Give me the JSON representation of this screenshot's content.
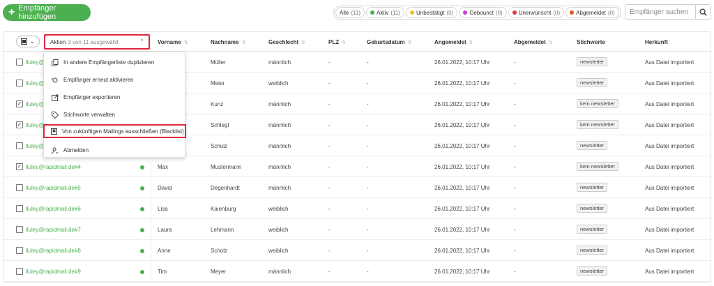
{
  "toolbar": {
    "add_label": "Empfänger hinzufügen",
    "search_placeholder": "Empfänger suchen",
    "filters": [
      {
        "label": "Alle",
        "count": "(11)",
        "color": ""
      },
      {
        "label": "Aktiv",
        "count": "(11)",
        "color": "#4caf50"
      },
      {
        "label": "Unbestätigt",
        "count": "(0)",
        "color": "#f0c020"
      },
      {
        "label": "Gebounct",
        "count": "(0)",
        "color": "#c040d0"
      },
      {
        "label": "Unerwünscht",
        "count": "(0)",
        "color": "#e0304a"
      },
      {
        "label": "Abgemeldet",
        "count": "(0)",
        "color": "#e05a20"
      }
    ]
  },
  "header": {
    "aktion_label": "Aktion",
    "aktion_selected": "3 von 11 ausgewählt",
    "columns": [
      "Vorname",
      "Nachname",
      "Geschlecht",
      "PLZ",
      "Geburtsdatum",
      "Angemeldet",
      "Abgemeldet",
      "Stichworte",
      "Herkunft"
    ]
  },
  "menu": {
    "items": [
      {
        "label": "In andere Empfängerliste duplizieren",
        "icon": "copy-icon"
      },
      {
        "label": "Empfänger erneut aktivieren",
        "icon": "reactivate-icon"
      },
      {
        "label": "Empfänger exportieren",
        "icon": "export-icon"
      },
      {
        "label": "Stichworte verwalten",
        "icon": "tag-icon"
      },
      {
        "label": "Von zukünftigen Mailings ausschließen (Blacklist)",
        "icon": "blacklist-icon"
      },
      {
        "label": "Abmelden",
        "icon": "unsubscribe-icon"
      }
    ]
  },
  "rows": [
    {
      "email": "lluley@rapidmail.de",
      "checked": false,
      "vorname": "",
      "nachname": "Müller",
      "geschlecht": "männlich",
      "plz": "-",
      "geburtsdatum": "-",
      "angemeldet": "26.01.2022, 10:17 Uhr",
      "abgemeldet": "-",
      "stichwort": "newsletter",
      "herkunft": "Aus Datei importiert"
    },
    {
      "email": "lluley@",
      "checked": false,
      "vorname": "",
      "nachname": "Meier",
      "geschlecht": "weiblich",
      "plz": "-",
      "geburtsdatum": "-",
      "angemeldet": "26.01.2022, 10:17 Uhr",
      "abgemeldet": "-",
      "stichwort": "newsletter",
      "herkunft": "Aus Datei importiert"
    },
    {
      "email": "lluley@",
      "checked": true,
      "vorname": "",
      "nachname": "Kunz",
      "geschlecht": "männlich",
      "plz": "-",
      "geburtsdatum": "-",
      "angemeldet": "26.01.2022, 10:17 Uhr",
      "abgemeldet": "-",
      "stichwort": "kein newsletter",
      "herkunft": "Aus Datei importiert"
    },
    {
      "email": "lluley@",
      "checked": true,
      "vorname": "",
      "nachname": "Schlegl",
      "geschlecht": "männlich",
      "plz": "-",
      "geburtsdatum": "-",
      "angemeldet": "26.01.2022, 10:17 Uhr",
      "abgemeldet": "-",
      "stichwort": "kein newsletter",
      "herkunft": "Aus Datei importiert"
    },
    {
      "email": "lluley@",
      "checked": false,
      "vorname": "",
      "nachname": "Schulz",
      "geschlecht": "männlich",
      "plz": "-",
      "geburtsdatum": "-",
      "angemeldet": "26.01.2022, 10:17 Uhr",
      "abgemeldet": "-",
      "stichwort": "newsletter",
      "herkunft": "Aus Datei importiert"
    },
    {
      "email": "lluley@rapidmail.de#4",
      "checked": true,
      "vorname": "Max",
      "nachname": "Mustermann",
      "geschlecht": "männlich",
      "plz": "-",
      "geburtsdatum": "-",
      "angemeldet": "26.01.2022, 10:17 Uhr",
      "abgemeldet": "-",
      "stichwort": "kein newsletter",
      "herkunft": "Aus Datei importiert"
    },
    {
      "email": "lluley@rapidmail.de#5",
      "checked": false,
      "vorname": "David",
      "nachname": "Degenhardt",
      "geschlecht": "männlich",
      "plz": "-",
      "geburtsdatum": "-",
      "angemeldet": "26.01.2022, 10:17 Uhr",
      "abgemeldet": "-",
      "stichwort": "newsletter",
      "herkunft": "Aus Datei importiert"
    },
    {
      "email": "lluley@rapidmail.de#6",
      "checked": false,
      "vorname": "Lisa",
      "nachname": "Kaienburg",
      "geschlecht": "weiblich",
      "plz": "-",
      "geburtsdatum": "-",
      "angemeldet": "26.01.2022, 10:17 Uhr",
      "abgemeldet": "-",
      "stichwort": "newsletter",
      "herkunft": "Aus Datei importiert"
    },
    {
      "email": "lluley@rapidmail.de#7",
      "checked": false,
      "vorname": "Laura",
      "nachname": "Lehmann",
      "geschlecht": "weiblich",
      "plz": "-",
      "geburtsdatum": "-",
      "angemeldet": "26.01.2022, 10:17 Uhr",
      "abgemeldet": "-",
      "stichwort": "newsletter",
      "herkunft": "Aus Datei importiert"
    },
    {
      "email": "lluley@rapidmail.de#8",
      "checked": false,
      "vorname": "Anne",
      "nachname": "Scholz",
      "geschlecht": "weiblich",
      "plz": "-",
      "geburtsdatum": "-",
      "angemeldet": "26.01.2022, 10:17 Uhr",
      "abgemeldet": "-",
      "stichwort": "newsletter",
      "herkunft": "Aus Datei importiert"
    },
    {
      "email": "lluley@rapidmail.de#9",
      "checked": false,
      "vorname": "Tim",
      "nachname": "Meyer",
      "geschlecht": "männlich",
      "plz": "-",
      "geburtsdatum": "-",
      "angemeldet": "26.01.2022, 10:17 Uhr",
      "abgemeldet": "-",
      "stichwort": "newsletter",
      "herkunft": "Aus Datei importiert"
    }
  ]
}
